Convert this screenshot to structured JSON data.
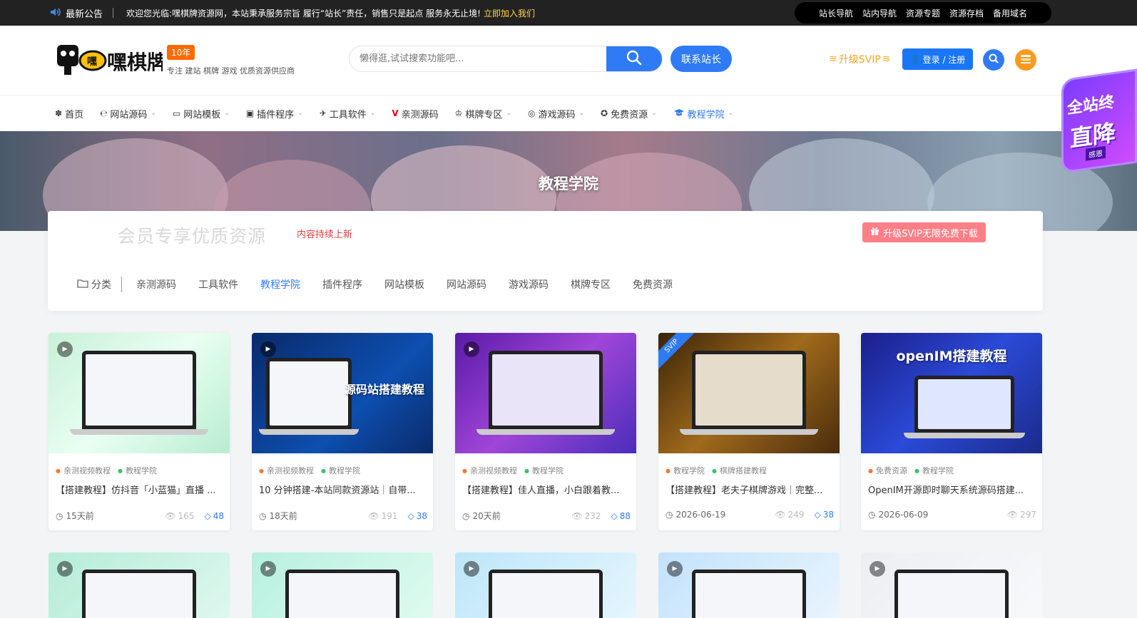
{
  "topbar": {
    "notice_label": "最新公告",
    "notice_text": "欢迎您光临:嘿棋牌资源网，本站秉承服务宗旨 履行“站长”责任，销售只是起点 服务永无止境!",
    "notice_link": "立即加入我们",
    "links": [
      "站长导航",
      "站内导航",
      "资源专题",
      "资源存档",
      "备用域名"
    ]
  },
  "header": {
    "logo_text": "嘿棋牌",
    "badge": "10年",
    "slogan": "专注 建站 棋牌 游戏 优质资源供应商",
    "search_placeholder": "懒得逛,试试搜索功能吧...",
    "contact_label": "联系站长",
    "svip_label": "升级SVIP",
    "login_label": "登录 / 注册"
  },
  "nav": [
    {
      "label": "首页",
      "icon": "✽"
    },
    {
      "label": "网站源码",
      "icon": "℮",
      "caret": true
    },
    {
      "label": "网站模板",
      "icon": "▭",
      "caret": true
    },
    {
      "label": "插件程序",
      "icon": "▣",
      "caret": true
    },
    {
      "label": "工具软件",
      "icon": "✈",
      "caret": true
    },
    {
      "label": "亲测源码",
      "icon": "V"
    },
    {
      "label": "棋牌专区",
      "icon": "♔",
      "caret": true
    },
    {
      "label": "游戏源码",
      "icon": "◎",
      "caret": true
    },
    {
      "label": "免费资源",
      "icon": "✪",
      "caret": true
    },
    {
      "label": "教程学院",
      "icon": "🎓",
      "caret": true,
      "active": true
    }
  ],
  "side_badge": {
    "line1": "全站终",
    "line2": "直降",
    "line3": "感恩"
  },
  "banner": {
    "title": "教程学院"
  },
  "panel": {
    "member_text": "会员专享优质资源",
    "update_text": "内容持续上新",
    "vip_button": "升级SVIP无限免费下载",
    "cat_label": "分类",
    "categories": [
      "亲测源码",
      "工具软件",
      "教程学院",
      "插件程序",
      "网站模板",
      "网站源码",
      "游戏源码",
      "棋牌专区",
      "免费资源"
    ],
    "active_category": "教程学院"
  },
  "cards": [
    {
      "tags": [
        "亲测视频教程",
        "教程学院"
      ],
      "title": "【搭建教程】仿抖音「小蓝猫」直播 ...",
      "time": "15天前",
      "views": "165",
      "diamonds": "48"
    },
    {
      "tags": [
        "亲测视频教程",
        "教程学院"
      ],
      "title": "10 分钟搭建-本站同款资源站｜自带...",
      "time": "18天前",
      "views": "191",
      "diamonds": "38",
      "thumb_title": "源码站搭建教程"
    },
    {
      "tags": [
        "亲测视频教程",
        "教程学院"
      ],
      "title": "【搭建教程】佳人直播，小白跟着教...",
      "time": "20天前",
      "views": "232",
      "diamonds": "88"
    },
    {
      "tags": [
        "教程学院",
        "棋牌搭建教程"
      ],
      "title": "【搭建教程】老夫子棋牌游戏｜完整...",
      "time": "2026-06-19",
      "views": "249",
      "diamonds": "38",
      "corner": "SVIP"
    },
    {
      "tags": [
        "免费资源",
        "教程学院"
      ],
      "title": "OpenIM开源即时聊天系统源码搭建...",
      "time": "2026-06-09",
      "views": "297",
      "thumb_title": "openIM搭建教程"
    }
  ]
}
